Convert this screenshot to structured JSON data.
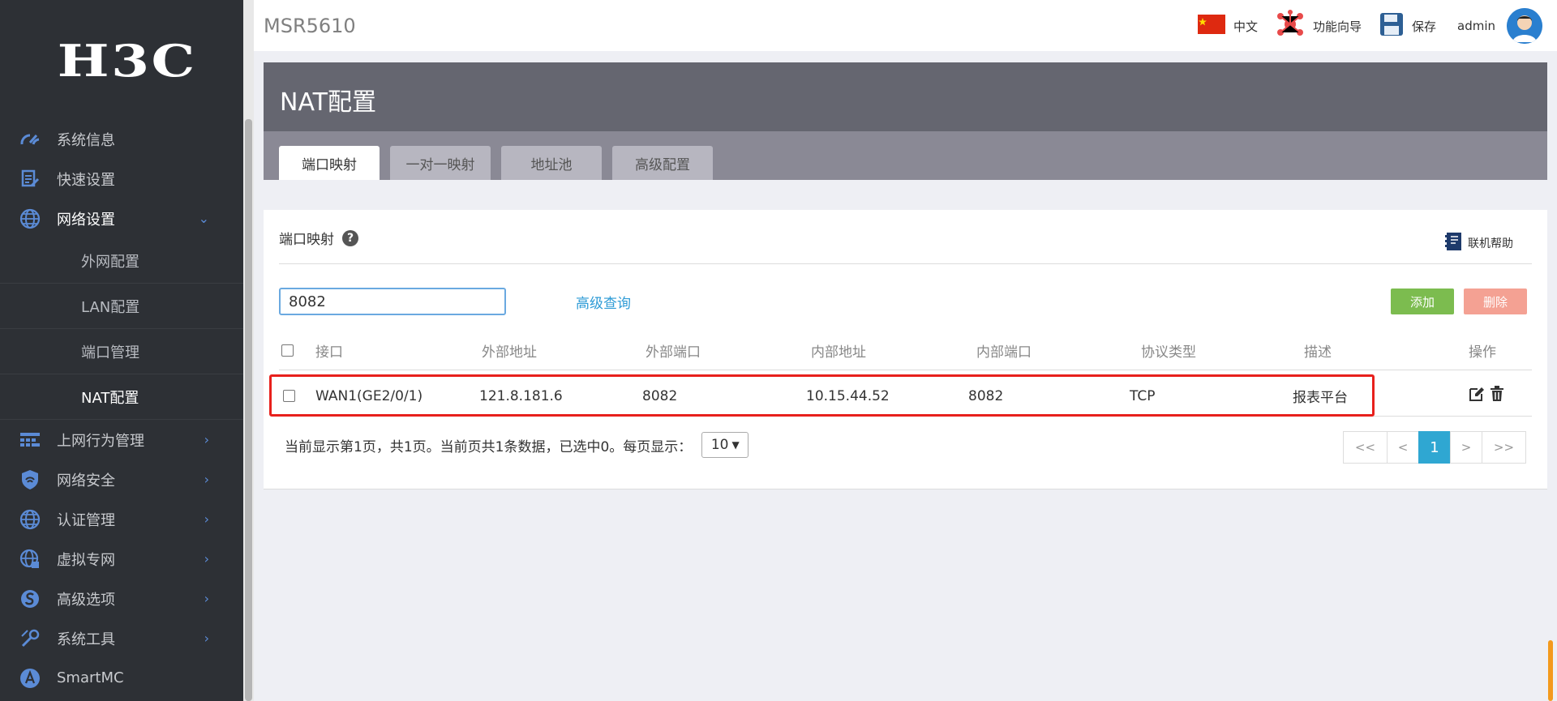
{
  "brand": {
    "logo_text": "H3C",
    "device_name": "MSR5610"
  },
  "header": {
    "language": "中文",
    "wizard": "功能向导",
    "save": "保存",
    "user": "admin"
  },
  "sidebar": {
    "items": [
      {
        "label": "系统信息",
        "icon": "dashboard-icon"
      },
      {
        "label": "快速设置",
        "icon": "quick-setup-icon"
      },
      {
        "label": "网络设置",
        "icon": "globe-icon",
        "expanded": true
      },
      {
        "label": "上网行为管理",
        "icon": "grid-icon"
      },
      {
        "label": "网络安全",
        "icon": "shield-icon"
      },
      {
        "label": "认证管理",
        "icon": "globe-icon"
      },
      {
        "label": "虚拟专网",
        "icon": "vpn-globe-icon"
      },
      {
        "label": "高级选项",
        "icon": "advanced-icon"
      },
      {
        "label": "系统工具",
        "icon": "tools-icon"
      },
      {
        "label": "SmartMC",
        "icon": "smartmc-icon"
      }
    ],
    "submenu": [
      {
        "label": "外网配置"
      },
      {
        "label": "LAN配置"
      },
      {
        "label": "端口管理"
      },
      {
        "label": "NAT配置",
        "active": true
      }
    ]
  },
  "page": {
    "title": "NAT配置",
    "tabs": [
      "端口映射",
      "一对一映射",
      "地址池",
      "高级配置"
    ],
    "active_tab": "端口映射"
  },
  "section": {
    "title": "端口映射",
    "online_help": "联机帮助",
    "search_value": "8082",
    "advanced_query": "高级查询",
    "add_label": "添加",
    "delete_label": "删除"
  },
  "table": {
    "columns": [
      "接口",
      "外部地址",
      "外部端口",
      "内部地址",
      "内部端口",
      "协议类型",
      "描述",
      "操作"
    ],
    "rows": [
      {
        "interface": "WAN1(GE2/0/1)",
        "external_address": "121.8.181.6",
        "external_port": "8082",
        "internal_address": "10.15.44.52",
        "internal_port": "8082",
        "protocol": "TCP",
        "description": "报表平台"
      }
    ]
  },
  "pagination": {
    "summary": "当前显示第1页，共1页。当前页共1条数据，已选中0。每页显示：",
    "page_size": "10",
    "first": "<<",
    "prev": "<",
    "current": "1",
    "next": ">",
    "last": ">>"
  },
  "colors": {
    "sidebar_bg": "#2d3035",
    "accent_blue": "#2fa7d2",
    "add_green": "#7cbc4f",
    "delete_red": "#f4a193",
    "highlight_red": "#e8201c"
  }
}
